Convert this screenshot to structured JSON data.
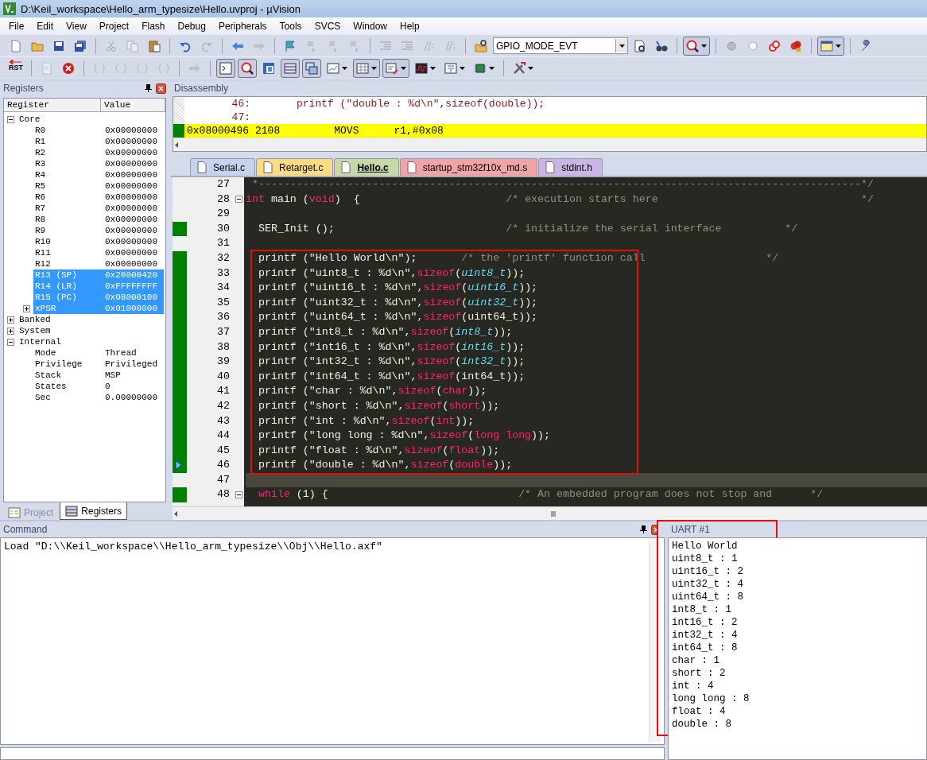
{
  "window": {
    "title": "D:\\Keil_workspace\\Hello_arm_typesize\\Hello.uvproj - µVision"
  },
  "menu": [
    "File",
    "Edit",
    "View",
    "Project",
    "Flash",
    "Debug",
    "Peripherals",
    "Tools",
    "SVCS",
    "Window",
    "Help"
  ],
  "toolbars": [
    [
      {
        "kind": "new",
        "disabled": false,
        "pressed": false,
        "dropdown": false
      },
      {
        "kind": "open",
        "disabled": false,
        "pressed": false,
        "dropdown": false
      },
      {
        "kind": "save",
        "disabled": false,
        "pressed": false,
        "dropdown": false
      },
      {
        "kind": "saveall",
        "disabled": false,
        "pressed": false,
        "dropdown": false
      },
      {
        "kind": "separator"
      },
      {
        "kind": "cut",
        "disabled": true,
        "pressed": false,
        "dropdown": false
      },
      {
        "kind": "copy",
        "disabled": true,
        "pressed": false,
        "dropdown": false
      },
      {
        "kind": "paste",
        "disabled": false,
        "pressed": false,
        "dropdown": false
      },
      {
        "kind": "separator"
      },
      {
        "kind": "undo",
        "disabled": false,
        "pressed": false,
        "dropdown": false
      },
      {
        "kind": "redo",
        "disabled": true,
        "pressed": false,
        "dropdown": false
      },
      {
        "kind": "separator"
      },
      {
        "kind": "back",
        "disabled": false,
        "pressed": false,
        "dropdown": false
      },
      {
        "kind": "forward",
        "disabled": true,
        "pressed": false,
        "dropdown": false
      },
      {
        "kind": "separator"
      },
      {
        "kind": "flag",
        "disabled": false,
        "pressed": false,
        "dropdown": false
      },
      {
        "kind": "bookmark",
        "disabled": true,
        "pressed": false,
        "dropdown": false
      },
      {
        "kind": "bookmark",
        "disabled": true,
        "pressed": false,
        "dropdown": false
      },
      {
        "kind": "bookmark",
        "disabled": true,
        "pressed": false,
        "dropdown": false
      },
      {
        "kind": "separator"
      },
      {
        "kind": "indent",
        "disabled": true,
        "pressed": false,
        "dropdown": false
      },
      {
        "kind": "indent",
        "disabled": true,
        "pressed": false,
        "dropdown": false
      },
      {
        "kind": "comment",
        "disabled": true,
        "pressed": false,
        "dropdown": false
      },
      {
        "kind": "comment",
        "disabled": true,
        "pressed": false,
        "dropdown": false
      },
      {
        "kind": "separator"
      },
      {
        "kind": "findfiles",
        "disabled": false,
        "pressed": false,
        "dropdown": false
      },
      {
        "kind": "combo",
        "value": "GPIO_MODE_EVT"
      },
      {
        "kind": "find",
        "disabled": false,
        "pressed": false,
        "dropdown": false
      },
      {
        "kind": "binoculars",
        "disabled": false,
        "pressed": false,
        "dropdown": false
      },
      {
        "kind": "separator"
      },
      {
        "kind": "debug",
        "disabled": false,
        "pressed": true,
        "dropdown": true
      },
      {
        "kind": "separator"
      },
      {
        "kind": "bpgrey",
        "disabled": false,
        "pressed": false,
        "dropdown": false
      },
      {
        "kind": "bpwhite",
        "disabled": false,
        "pressed": false,
        "dropdown": false
      },
      {
        "kind": "bprings",
        "disabled": false,
        "pressed": false,
        "dropdown": false
      },
      {
        "kind": "bpkill",
        "disabled": false,
        "pressed": false,
        "dropdown": false
      },
      {
        "kind": "separator"
      },
      {
        "kind": "window",
        "disabled": false,
        "pressed": true,
        "dropdown": true
      },
      {
        "kind": "separator"
      },
      {
        "kind": "wrench",
        "disabled": false,
        "pressed": false,
        "dropdown": false
      }
    ],
    [
      {
        "kind": "reset",
        "label": "RST"
      },
      {
        "kind": "separator"
      },
      {
        "kind": "run",
        "disabled": true,
        "pressed": false,
        "dropdown": false
      },
      {
        "kind": "stop",
        "disabled": false,
        "pressed": false,
        "dropdown": false
      },
      {
        "kind": "separator"
      },
      {
        "kind": "braces",
        "disabled": true,
        "pressed": false,
        "dropdown": false
      },
      {
        "kind": "braces",
        "disabled": true,
        "pressed": false,
        "dropdown": false
      },
      {
        "kind": "braces",
        "disabled": true,
        "pressed": false,
        "dropdown": false
      },
      {
        "kind": "braces",
        "disabled": true,
        "pressed": false,
        "dropdown": false
      },
      {
        "kind": "separator"
      },
      {
        "kind": "forward",
        "disabled": true,
        "pressed": false,
        "dropdown": false
      },
      {
        "kind": "separator"
      },
      {
        "kind": "terminal",
        "disabled": false,
        "pressed": true,
        "dropdown": false
      },
      {
        "kind": "debug",
        "disabled": false,
        "pressed": true,
        "dropdown": false
      },
      {
        "kind": "symbols",
        "disabled": false,
        "pressed": false,
        "dropdown": false
      },
      {
        "kind": "list",
        "disabled": false,
        "pressed": true,
        "dropdown": false
      },
      {
        "kind": "windows",
        "disabled": false,
        "pressed": true,
        "dropdown": false
      },
      {
        "kind": "watch",
        "disabled": false,
        "pressed": false,
        "dropdown": true
      },
      {
        "kind": "grid",
        "disabled": false,
        "pressed": true,
        "dropdown": true
      },
      {
        "kind": "serial",
        "disabled": false,
        "pressed": true,
        "dropdown": true
      },
      {
        "kind": "chart",
        "disabled": false,
        "pressed": false,
        "dropdown": true
      },
      {
        "kind": "trace",
        "disabled": false,
        "pressed": false,
        "dropdown": true
      },
      {
        "kind": "chip",
        "disabled": false,
        "pressed": false,
        "dropdown": true
      },
      {
        "kind": "separator"
      },
      {
        "kind": "tools",
        "disabled": false,
        "pressed": false,
        "dropdown": true
      }
    ]
  ],
  "registers_panel": {
    "title": "Registers",
    "columns": [
      "Register",
      "Value"
    ],
    "tree": [
      {
        "name": "Core",
        "expanded": true,
        "selected": false,
        "children": [
          {
            "name": "R0",
            "value": "0x00000000",
            "selected": false
          },
          {
            "name": "R1",
            "value": "0x00000000",
            "selected": false
          },
          {
            "name": "R2",
            "value": "0x00000000",
            "selected": false
          },
          {
            "name": "R3",
            "value": "0x00000000",
            "selected": false
          },
          {
            "name": "R4",
            "value": "0x00000000",
            "selected": false
          },
          {
            "name": "R5",
            "value": "0x00000000",
            "selected": false
          },
          {
            "name": "R6",
            "value": "0x00000000",
            "selected": false
          },
          {
            "name": "R7",
            "value": "0x00000000",
            "selected": false
          },
          {
            "name": "R8",
            "value": "0x00000000",
            "selected": false
          },
          {
            "name": "R9",
            "value": "0x00000000",
            "selected": false
          },
          {
            "name": "R10",
            "value": "0x00000000",
            "selected": false
          },
          {
            "name": "R11",
            "value": "0x00000000",
            "selected": false
          },
          {
            "name": "R12",
            "value": "0x00000000",
            "selected": false
          },
          {
            "name": "R13 (SP)",
            "value": "0x20000420",
            "selected": true
          },
          {
            "name": "R14 (LR)",
            "value": "0xFFFFFFFF",
            "selected": true
          },
          {
            "name": "R15 (PC)",
            "value": "0x08000100",
            "selected": true
          },
          {
            "name": "xPSR",
            "value": "0x01000000",
            "selected": true,
            "expanded": false
          }
        ]
      },
      {
        "name": "Banked",
        "expanded": false,
        "selected": false
      },
      {
        "name": "System",
        "expanded": false,
        "selected": false
      },
      {
        "name": "Internal",
        "expanded": true,
        "selected": false,
        "children": [
          {
            "name": "Mode",
            "value": "Thread",
            "selected": false
          },
          {
            "name": "Privilege",
            "value": "Privileged",
            "selected": false
          },
          {
            "name": "Stack",
            "value": "MSP",
            "selected": false
          },
          {
            "name": "States",
            "value": "0",
            "selected": false
          },
          {
            "name": "Sec",
            "value": "0.00000000",
            "selected": false
          }
        ]
      }
    ],
    "tabs": [
      {
        "label": "Project",
        "selected": false
      },
      {
        "label": "Registers",
        "selected": true
      }
    ]
  },
  "disassembly": {
    "title": "Disassembly",
    "lines": [
      {
        "kind": "source",
        "number": "46:",
        "text": "printf (\"double : %d\\n\",sizeof(double));",
        "current": false
      },
      {
        "kind": "source",
        "number": "47:",
        "current": false
      },
      {
        "kind": "instruction",
        "address": "0x08000496",
        "opcode": "2108",
        "mnemonic": "MOVS",
        "operands": "r1,#0x08",
        "current": true
      }
    ]
  },
  "editor": {
    "tabs": [
      {
        "label": "Serial.c",
        "color": "#c5d3ef",
        "selected": false
      },
      {
        "label": "Retarget.c",
        "color": "#f9dc84",
        "selected": false
      },
      {
        "label": "Hello.c",
        "color": "#c8d9a9",
        "selected": true
      },
      {
        "label": "startup_stm32f10x_md.s",
        "color": "#f0a4a4",
        "selected": false
      },
      {
        "label": "stdint.h",
        "color": "#c9b6e5",
        "selected": false
      }
    ],
    "lines": [
      {
        "number": "27",
        "executed": false,
        "arrow": false,
        "highlighted": false,
        "boxed": false,
        "fold": false,
        "segments": [
          {
            "kind": "comment",
            "text": " *-----------------------------------------------------------------------------------------------*/"
          }
        ]
      },
      {
        "number": "28",
        "executed": false,
        "arrow": false,
        "highlighted": false,
        "boxed": false,
        "fold": true,
        "segments": [
          {
            "kind": "keyword",
            "text": "int"
          },
          {
            "kind": "plain",
            "text": " main ("
          },
          {
            "kind": "keyword",
            "text": "void"
          },
          {
            "kind": "plain",
            "text": ")  {                       "
          },
          {
            "kind": "comment",
            "text": "/* execution starts here                                */"
          }
        ]
      },
      {
        "number": "29",
        "executed": false,
        "arrow": false,
        "highlighted": false,
        "boxed": false,
        "fold": false
      },
      {
        "number": "30",
        "executed": true,
        "arrow": false,
        "highlighted": false,
        "boxed": false,
        "fold": false,
        "segments": [
          {
            "kind": "plain",
            "text": "  SER_Init ();                           "
          },
          {
            "kind": "comment",
            "text": "/* initialize the serial interface          */"
          }
        ]
      },
      {
        "number": "31",
        "executed": false,
        "arrow": false,
        "highlighted": false,
        "boxed": false,
        "fold": false
      },
      {
        "number": "32",
        "executed": true,
        "arrow": false,
        "highlighted": false,
        "boxed": true,
        "fold": false,
        "segments": [
          {
            "kind": "plain",
            "text": "  printf (\"Hello World\\n\");       "
          },
          {
            "kind": "comment",
            "text": "/* the 'printf' function call                   */"
          }
        ]
      },
      {
        "number": "33",
        "executed": true,
        "arrow": false,
        "highlighted": false,
        "boxed": true,
        "fold": false,
        "segments": [
          {
            "kind": "plain",
            "text": "  printf (\"uint8_t : %d\\n\","
          },
          {
            "kind": "keyword",
            "text": "sizeof"
          },
          {
            "kind": "plain",
            "text": "("
          },
          {
            "kind": "type",
            "text": "uint8_t"
          },
          {
            "kind": "plain",
            "text": "));"
          }
        ]
      },
      {
        "number": "34",
        "executed": true,
        "arrow": false,
        "highlighted": false,
        "boxed": true,
        "fold": false,
        "segments": [
          {
            "kind": "plain",
            "text": "  printf (\"uint16_t : %d\\n\","
          },
          {
            "kind": "keyword",
            "text": "sizeof"
          },
          {
            "kind": "plain",
            "text": "("
          },
          {
            "kind": "type",
            "text": "uint16_t"
          },
          {
            "kind": "plain",
            "text": "));"
          }
        ]
      },
      {
        "number": "35",
        "executed": true,
        "arrow": false,
        "highlighted": false,
        "boxed": true,
        "fold": false,
        "segments": [
          {
            "kind": "plain",
            "text": "  printf (\"uint32_t : %d\\n\","
          },
          {
            "kind": "keyword",
            "text": "sizeof"
          },
          {
            "kind": "plain",
            "text": "("
          },
          {
            "kind": "type",
            "text": "uint32_t"
          },
          {
            "kind": "plain",
            "text": "));"
          }
        ]
      },
      {
        "number": "36",
        "executed": true,
        "arrow": false,
        "highlighted": false,
        "boxed": true,
        "fold": false,
        "segments": [
          {
            "kind": "plain",
            "text": "  printf (\"uint64_t : %d\\n\","
          },
          {
            "kind": "keyword",
            "text": "sizeof"
          },
          {
            "kind": "plain",
            "text": "(uint64_t));"
          }
        ]
      },
      {
        "number": "37",
        "executed": true,
        "arrow": false,
        "highlighted": false,
        "boxed": true,
        "fold": false,
        "segments": [
          {
            "kind": "plain",
            "text": "  printf (\"int8_t : %d\\n\","
          },
          {
            "kind": "keyword",
            "text": "sizeof"
          },
          {
            "kind": "plain",
            "text": "("
          },
          {
            "kind": "type",
            "text": "int8_t"
          },
          {
            "kind": "plain",
            "text": "));"
          }
        ]
      },
      {
        "number": "38",
        "executed": true,
        "arrow": false,
        "highlighted": false,
        "boxed": true,
        "fold": false,
        "segments": [
          {
            "kind": "plain",
            "text": "  printf (\"int16_t : %d\\n\","
          },
          {
            "kind": "keyword",
            "text": "sizeof"
          },
          {
            "kind": "plain",
            "text": "("
          },
          {
            "kind": "type",
            "text": "int16_t"
          },
          {
            "kind": "plain",
            "text": "));"
          }
        ]
      },
      {
        "number": "39",
        "executed": true,
        "arrow": false,
        "highlighted": false,
        "boxed": true,
        "fold": false,
        "segments": [
          {
            "kind": "plain",
            "text": "  printf (\"int32_t : %d\\n\","
          },
          {
            "kind": "keyword",
            "text": "sizeof"
          },
          {
            "kind": "plain",
            "text": "("
          },
          {
            "kind": "type",
            "text": "int32_t"
          },
          {
            "kind": "plain",
            "text": "));"
          }
        ]
      },
      {
        "number": "40",
        "executed": true,
        "arrow": false,
        "highlighted": false,
        "boxed": true,
        "fold": false,
        "segments": [
          {
            "kind": "plain",
            "text": "  printf (\"int64_t : %d\\n\","
          },
          {
            "kind": "keyword",
            "text": "sizeof"
          },
          {
            "kind": "plain",
            "text": "(int64_t));"
          }
        ]
      },
      {
        "number": "41",
        "executed": true,
        "arrow": false,
        "highlighted": false,
        "boxed": true,
        "fold": false,
        "segments": [
          {
            "kind": "plain",
            "text": "  printf (\"char : %d\\n\","
          },
          {
            "kind": "keyword",
            "text": "sizeof"
          },
          {
            "kind": "plain",
            "text": "("
          },
          {
            "kind": "keyword",
            "text": "char"
          },
          {
            "kind": "plain",
            "text": "));"
          }
        ]
      },
      {
        "number": "42",
        "executed": true,
        "arrow": false,
        "highlighted": false,
        "boxed": true,
        "fold": false,
        "segments": [
          {
            "kind": "plain",
            "text": "  printf (\"short : %d\\n\","
          },
          {
            "kind": "keyword",
            "text": "sizeof"
          },
          {
            "kind": "plain",
            "text": "("
          },
          {
            "kind": "keyword",
            "text": "short"
          },
          {
            "kind": "plain",
            "text": "));"
          }
        ]
      },
      {
        "number": "43",
        "executed": true,
        "arrow": false,
        "highlighted": false,
        "boxed": true,
        "fold": false,
        "segments": [
          {
            "kind": "plain",
            "text": "  printf (\"int : %d\\n\","
          },
          {
            "kind": "keyword",
            "text": "sizeof"
          },
          {
            "kind": "plain",
            "text": "("
          },
          {
            "kind": "keyword",
            "text": "int"
          },
          {
            "kind": "plain",
            "text": "));"
          }
        ]
      },
      {
        "number": "44",
        "executed": true,
        "arrow": false,
        "highlighted": false,
        "boxed": true,
        "fold": false,
        "segments": [
          {
            "kind": "plain",
            "text": "  printf (\"long long : %d\\n\","
          },
          {
            "kind": "keyword",
            "text": "sizeof"
          },
          {
            "kind": "plain",
            "text": "("
          },
          {
            "kind": "keyword",
            "text": "long long"
          },
          {
            "kind": "plain",
            "text": "));"
          }
        ]
      },
      {
        "number": "45",
        "executed": true,
        "arrow": false,
        "highlighted": false,
        "boxed": true,
        "fold": false,
        "segments": [
          {
            "kind": "plain",
            "text": "  printf (\"float : %d\\n\","
          },
          {
            "kind": "keyword",
            "text": "sizeof"
          },
          {
            "kind": "plain",
            "text": "("
          },
          {
            "kind": "keyword",
            "text": "float"
          },
          {
            "kind": "plain",
            "text": "));"
          }
        ]
      },
      {
        "number": "46",
        "executed": true,
        "arrow": true,
        "highlighted": false,
        "boxed": true,
        "fold": false,
        "segments": [
          {
            "kind": "plain",
            "text": "  printf (\"double : %d\\n\","
          },
          {
            "kind": "keyword",
            "text": "sizeof"
          },
          {
            "kind": "plain",
            "text": "("
          },
          {
            "kind": "keyword",
            "text": "double"
          },
          {
            "kind": "plain",
            "text": "));"
          }
        ]
      },
      {
        "number": "47",
        "executed": false,
        "arrow": false,
        "highlighted": true,
        "boxed": false,
        "fold": false
      },
      {
        "number": "48",
        "executed": true,
        "arrow": false,
        "highlighted": false,
        "boxed": false,
        "fold": true,
        "segments": [
          {
            "kind": "keyword",
            "text": "  while"
          },
          {
            "kind": "plain",
            "text": " (1) {                              "
          },
          {
            "kind": "comment",
            "text": "/* An embedded program does not stop and      */"
          }
        ]
      }
    ]
  },
  "command": {
    "title": "Command",
    "lines": [
      "Load \"D:\\\\Keil_workspace\\\\Hello_arm_typesize\\\\Obj\\\\Hello.axf\""
    ]
  },
  "uart": {
    "title": "UART #1",
    "boxed": true,
    "lines": [
      "Hello World",
      "uint8_t : 1",
      "uint16_t : 2",
      "uint32_t : 4",
      "uint64_t : 8",
      "int8_t : 1",
      "int16_t : 2",
      "int32_t : 4",
      "int64_t : 8",
      "char : 1",
      "short : 2",
      "int : 4",
      "long long : 8",
      "float : 4",
      "double : 8"
    ]
  }
}
